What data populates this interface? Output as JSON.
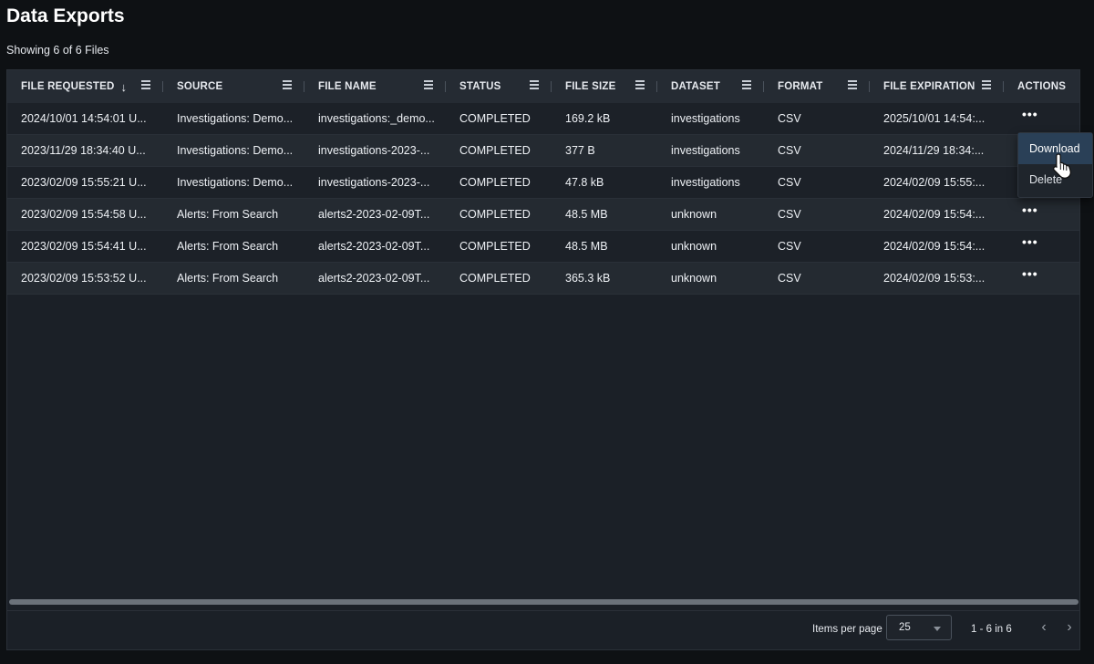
{
  "page": {
    "title": "Data Exports",
    "subtitle": "Showing 6 of 6 Files"
  },
  "columns": [
    {
      "label": "FILE REQUESTED",
      "sorted": "desc"
    },
    {
      "label": "SOURCE"
    },
    {
      "label": "FILE NAME"
    },
    {
      "label": "STATUS"
    },
    {
      "label": "FILE SIZE"
    },
    {
      "label": "DATASET"
    },
    {
      "label": "FORMAT"
    },
    {
      "label": "FILE EXPIRATION"
    },
    {
      "label": "ACTIONS"
    }
  ],
  "rows": [
    {
      "requested": "2024/10/01 14:54:01 U...",
      "source": "Investigations: Demo...",
      "file_name": "investigations:_demo...",
      "status": "COMPLETED",
      "size": "169.2 kB",
      "dataset": "investigations",
      "format": "CSV",
      "expiration": "2025/10/01 14:54:...",
      "actions": "•••"
    },
    {
      "requested": "2023/11/29 18:34:40 U...",
      "source": "Investigations: Demo...",
      "file_name": "investigations-2023-...",
      "status": "COMPLETED",
      "size": "377 B",
      "dataset": "investigations",
      "format": "CSV",
      "expiration": "2024/11/29 18:34:...",
      "actions": ""
    },
    {
      "requested": "2023/02/09 15:55:21 U...",
      "source": "Investigations: Demo...",
      "file_name": "investigations-2023-...",
      "status": "COMPLETED",
      "size": "47.8 kB",
      "dataset": "investigations",
      "format": "CSV",
      "expiration": "2024/02/09 15:55:...",
      "actions": ""
    },
    {
      "requested": "2023/02/09 15:54:58 U...",
      "source": "Alerts: From Search",
      "file_name": "alerts2-2023-02-09T...",
      "status": "COMPLETED",
      "size": "48.5 MB",
      "dataset": "unknown",
      "format": "CSV",
      "expiration": "2024/02/09 15:54:...",
      "actions": "•••"
    },
    {
      "requested": "2023/02/09 15:54:41 U...",
      "source": "Alerts: From Search",
      "file_name": "alerts2-2023-02-09T...",
      "status": "COMPLETED",
      "size": "48.5 MB",
      "dataset": "unknown",
      "format": "CSV",
      "expiration": "2024/02/09 15:54:...",
      "actions": "•••"
    },
    {
      "requested": "2023/02/09 15:53:52 U...",
      "source": "Alerts: From Search",
      "file_name": "alerts2-2023-02-09T...",
      "status": "COMPLETED",
      "size": "365.3 kB",
      "dataset": "unknown",
      "format": "CSV",
      "expiration": "2024/02/09 15:53:...",
      "actions": "•••"
    }
  ],
  "context_menu": {
    "download": "Download",
    "delete": "Delete"
  },
  "footer": {
    "items_per_page_label": "Items per page",
    "items_per_page_value": "25",
    "range": "1 - 6 in 6",
    "prev": "‹",
    "next": "›"
  }
}
